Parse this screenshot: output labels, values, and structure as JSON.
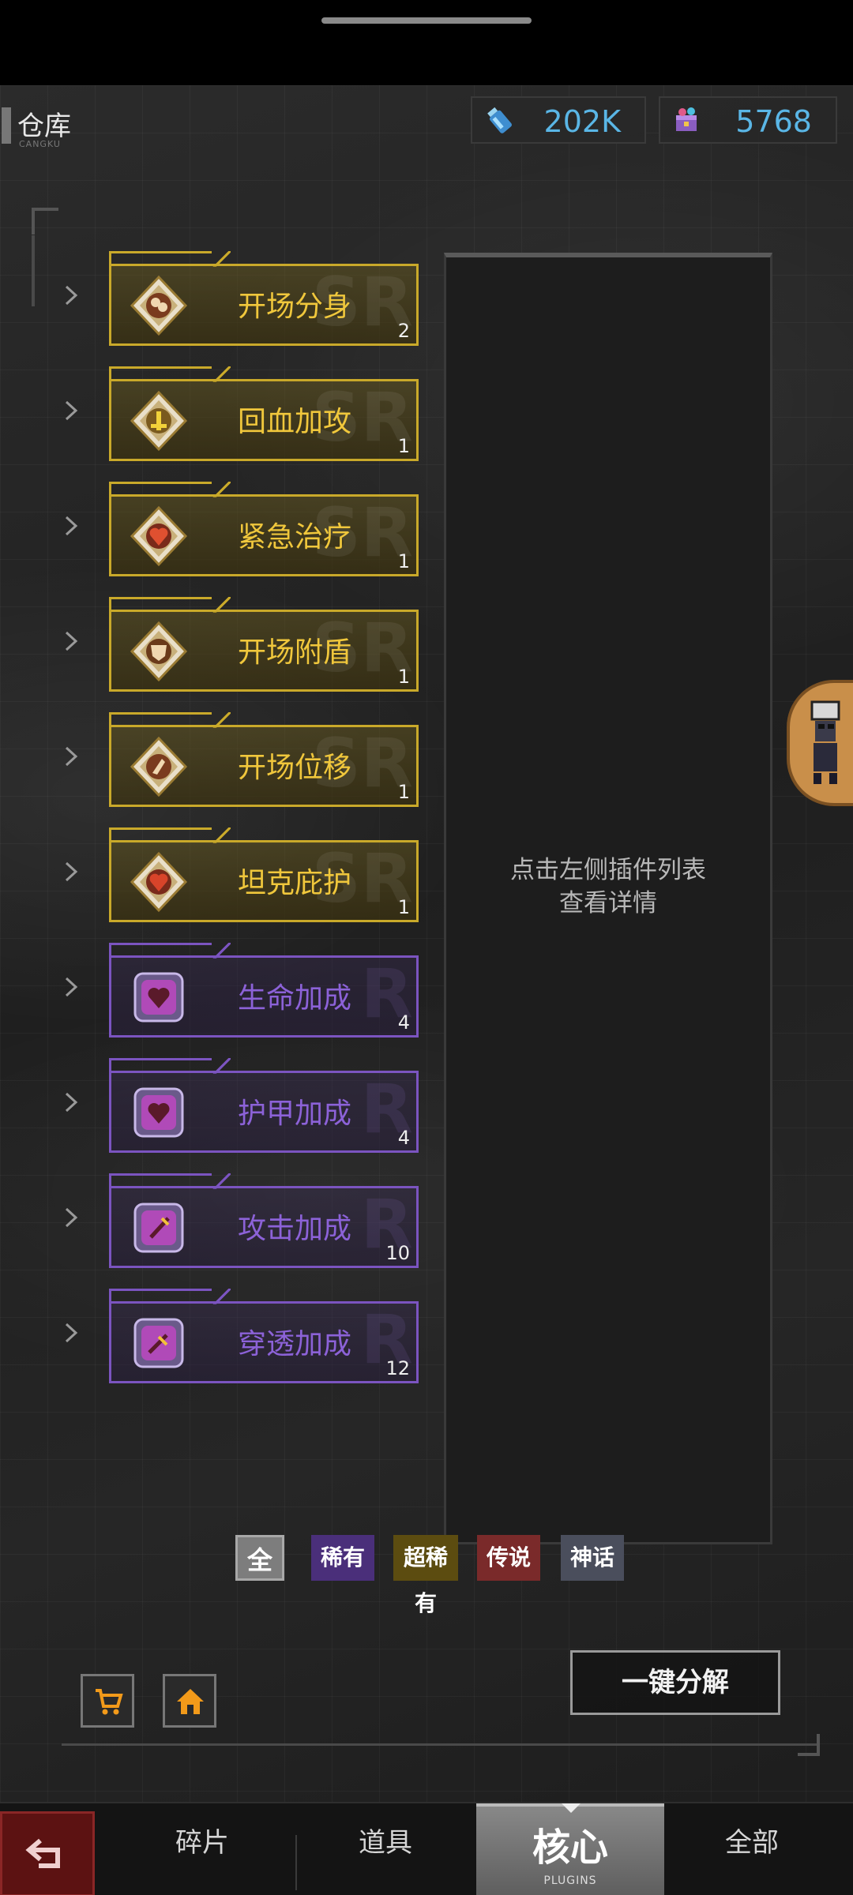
{
  "header": {
    "title": "仓库",
    "title_sub": "CANGKU",
    "resources": [
      {
        "icon": "energy-bottle-icon",
        "value": "202K"
      },
      {
        "icon": "gem-chest-icon",
        "value": "5768"
      }
    ]
  },
  "plugins": [
    {
      "name": "开场分身",
      "count": "2",
      "rarity": "SR",
      "icon": "clone-badge-icon"
    },
    {
      "name": "回血加攻",
      "count": "1",
      "rarity": "SR",
      "icon": "heal-attack-badge-icon"
    },
    {
      "name": "紧急治疗",
      "count": "1",
      "rarity": "SR",
      "icon": "emergency-heal-badge-icon"
    },
    {
      "name": "开场附盾",
      "count": "1",
      "rarity": "SR",
      "icon": "shield-badge-icon"
    },
    {
      "name": "开场位移",
      "count": "1",
      "rarity": "SR",
      "icon": "dash-badge-icon"
    },
    {
      "name": "坦克庇护",
      "count": "1",
      "rarity": "SR",
      "icon": "tank-shelter-badge-icon"
    },
    {
      "name": "生命加成",
      "count": "4",
      "rarity": "R",
      "icon": "life-bonus-badge-icon"
    },
    {
      "name": "护甲加成",
      "count": "4",
      "rarity": "R",
      "icon": "armor-bonus-badge-icon"
    },
    {
      "name": "攻击加成",
      "count": "10",
      "rarity": "R",
      "icon": "attack-bonus-badge-icon"
    },
    {
      "name": "穿透加成",
      "count": "12",
      "rarity": "R",
      "icon": "pierce-bonus-badge-icon"
    }
  ],
  "detail": {
    "hint_line1": "点击左侧插件列表",
    "hint_line2": "查看详情"
  },
  "filters": [
    "全",
    "稀有",
    "超稀有",
    "传说",
    "神话"
  ],
  "actions": {
    "decompose": "一键分解",
    "shop_icon": "cart-icon",
    "home_icon": "home-icon"
  },
  "nav": {
    "fragments": "碎片",
    "items": "道具",
    "core": "核心",
    "core_sub": "PLUGINS",
    "all": "全部"
  },
  "colors": {
    "sr_gold": "#c9a92a",
    "r_purple": "#7b54c0",
    "resource_blue": "#5ab6e6"
  }
}
